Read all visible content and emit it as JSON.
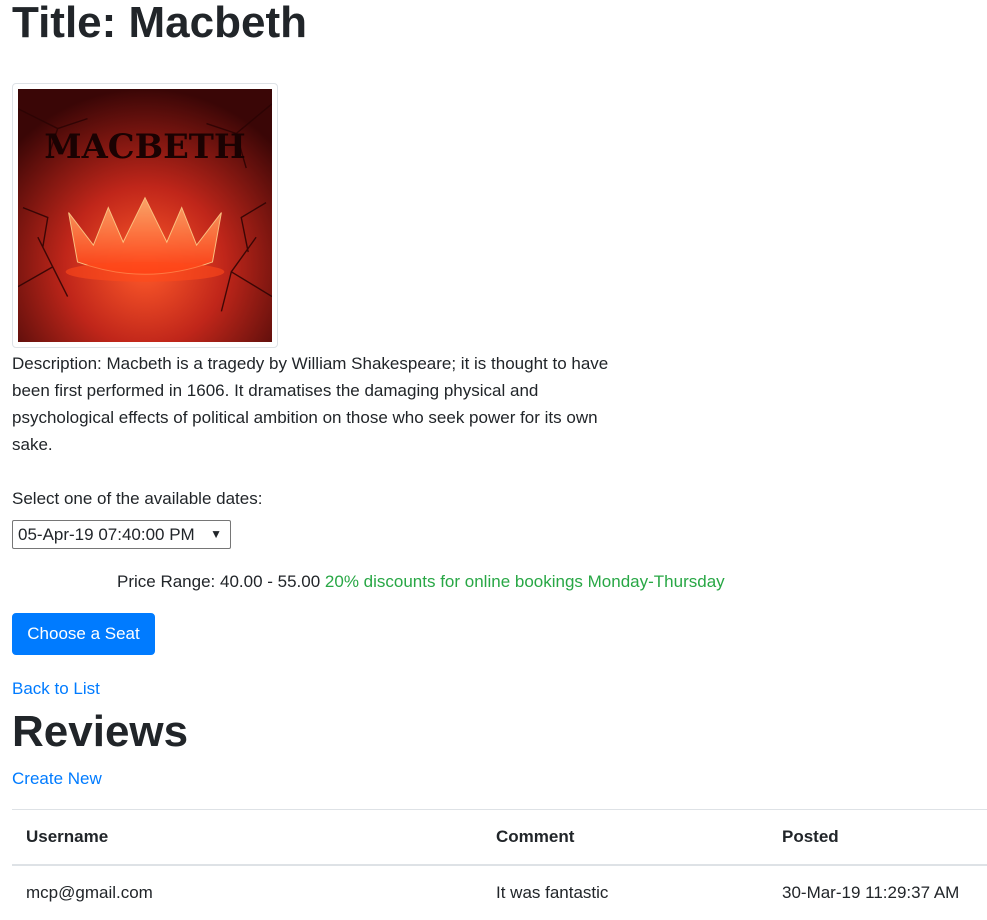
{
  "page": {
    "title": "Title: Macbeth",
    "poster_alt_text": "MACBETH",
    "description": "Description: Macbeth is a tragedy by William Shakespeare; it is thought to have been first performed in 1606. It dramatises the damaging physical and psychological effects of political ambition on those who seek power for its own sake.",
    "select_label": "Select one of the available dates:",
    "selected_date": "05-Apr-19 07:40:00 PM",
    "price_range": "Price Range: 40.00 - 55.00",
    "discount_note": "20% discounts for online bookings Monday-Thursday",
    "choose_seat_label": "Choose a Seat",
    "back_link": "Back to List",
    "reviews_heading": "Reviews",
    "create_link": "Create New"
  },
  "reviews": {
    "columns": [
      "Username",
      "Comment",
      "Posted"
    ],
    "rows": [
      {
        "username": "mcp@gmail.com",
        "comment": "It was fantastic",
        "posted": "30-Mar-19 11:29:37 AM"
      }
    ]
  },
  "colors": {
    "primary": "#007bff",
    "discount": "#28a745",
    "text": "#212529",
    "poster_bg": "#c0261a"
  }
}
